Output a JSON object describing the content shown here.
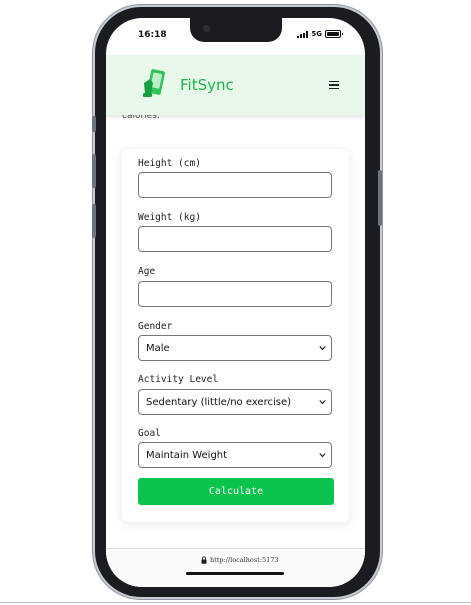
{
  "status": {
    "time": "16:18",
    "network": "5G"
  },
  "header": {
    "brand": "FitSync",
    "logo_icon": "phone-fitness-logo-icon",
    "menu_icon": "hamburger-menu-icon"
  },
  "intro_partial_text": "calories.",
  "form": {
    "height_label": "Height (cm)",
    "height_value": "",
    "weight_label": "Weight (kg)",
    "weight_value": "",
    "age_label": "Age",
    "age_value": "",
    "gender_label": "Gender",
    "gender_selected": "Male",
    "activity_label": "Activity Level",
    "activity_selected": "Sedentary (little/no exercise)",
    "goal_label": "Goal",
    "goal_selected": "Maintain Weight",
    "calculate_label": "Calculate"
  },
  "browser": {
    "url": "http://localhost:5173"
  },
  "colors": {
    "accent": "#0bc44e",
    "brand": "#1fb34a",
    "header_bg": "#e8f8ea"
  }
}
